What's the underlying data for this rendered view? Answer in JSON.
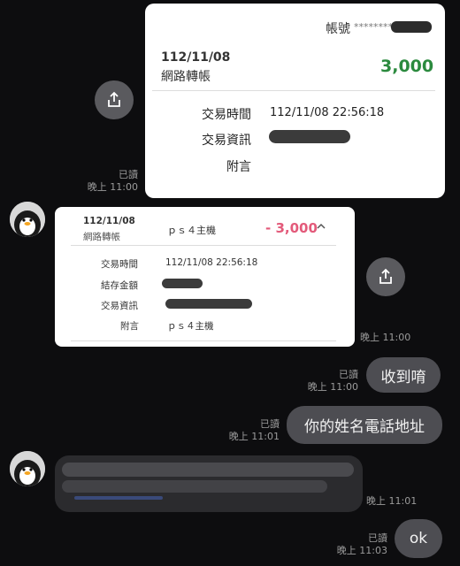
{
  "colors": {
    "background": "#0d0d0f",
    "amount_in": "#2b8a3e",
    "amount_out": "#e35a7a",
    "bubble": "#4d4d52"
  },
  "receipt1": {
    "account_label": "帳號",
    "account_masked": "*********",
    "date": "112/11/08",
    "type": "網路轉帳",
    "amount": "3,000",
    "time_label": "交易時間",
    "time_value": "112/11/08 22:56:18",
    "info_label": "交易資訊",
    "note_label": "附言"
  },
  "receipt2": {
    "date": "112/11/08",
    "type": "網路轉帳",
    "memo": "ｐｓ４主機",
    "amount": "- 3,000",
    "time_label": "交易時間",
    "time_value": "112/11/08 22:56:18",
    "balance_label": "結存金額",
    "info_label": "交易資訊",
    "note_label": "附言",
    "note_value": "ｐｓ４主機"
  },
  "messages": [
    {
      "read": "已讀",
      "time": "晚上 11:00"
    },
    {
      "time": "晚上 11:00"
    },
    {
      "read": "已讀",
      "time": "晚上 11:00",
      "text": "收到唷"
    },
    {
      "read": "已讀",
      "time": "晚上 11:01",
      "text": "你的姓名電話地址"
    },
    {
      "time": "晚上 11:01"
    },
    {
      "read": "已讀",
      "time": "晚上 11:03",
      "text": "ok"
    }
  ],
  "icons": {
    "share": "share-icon",
    "avatar": "penguin-avatar",
    "expand": "chevron-up-icon"
  }
}
